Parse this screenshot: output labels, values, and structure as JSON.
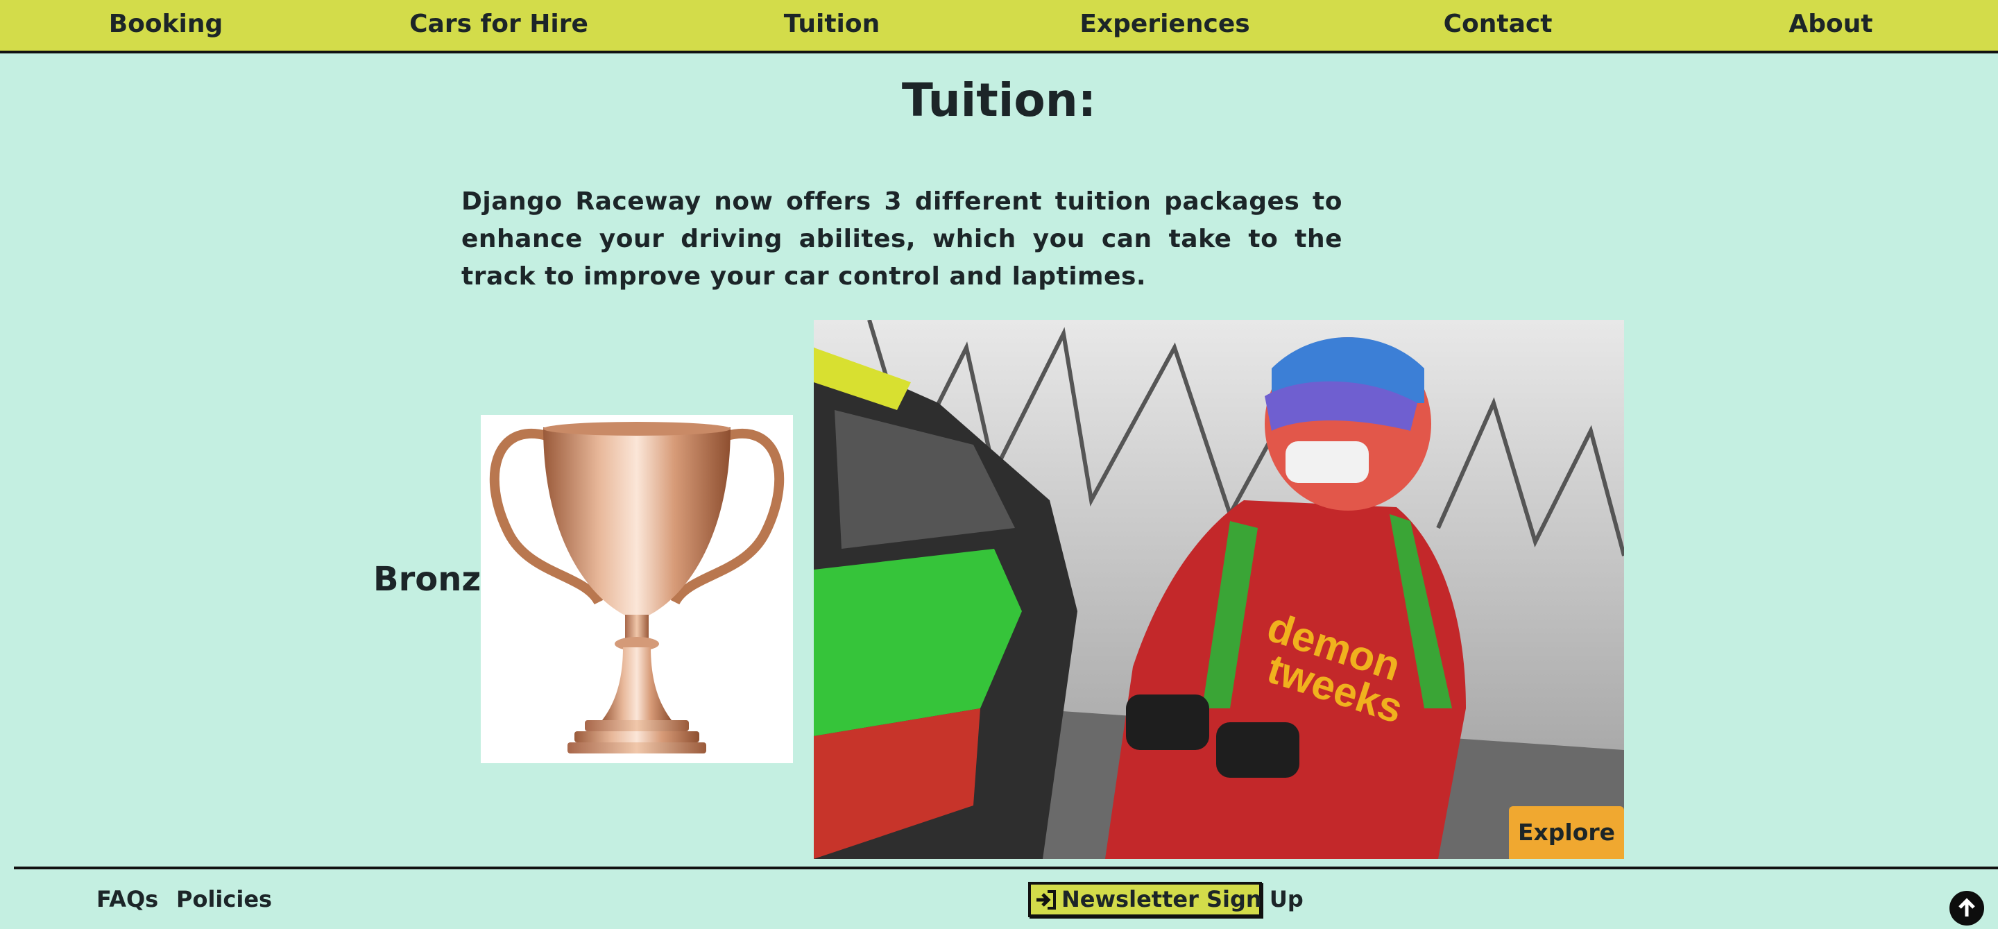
{
  "nav": {
    "items": [
      {
        "label": "Booking"
      },
      {
        "label": "Cars for Hire"
      },
      {
        "label": "Tuition"
      },
      {
        "label": "Experiences"
      },
      {
        "label": "Contact"
      },
      {
        "label": "About"
      }
    ]
  },
  "main": {
    "title": "Tuition:",
    "intro": "Django Raceway now offers 3 different tuition packages to enhance your driving abilites, which you can take to the track to improve your car control and laptimes.",
    "package": {
      "label": "Bronze",
      "explore_label": "Explore"
    }
  },
  "footer": {
    "links": [
      {
        "label": "FAQs"
      },
      {
        "label": "Policies"
      }
    ],
    "newsletter_label": "Newsletter Sign Up",
    "newsletter_icon": "sign-in-icon",
    "back_to_top_icon": "arrow-up-icon"
  },
  "colors": {
    "background": "#c4efe1",
    "navbar": "#d3dc4a",
    "explore_button": "#f0a830",
    "text": "#1c2528"
  }
}
